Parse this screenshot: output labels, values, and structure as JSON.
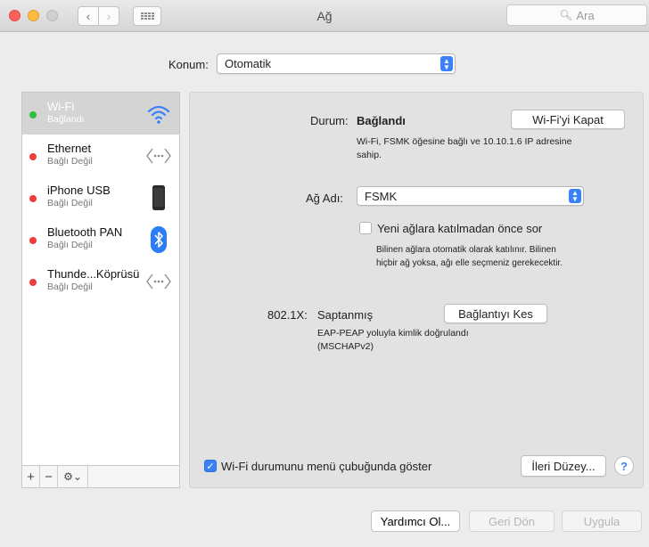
{
  "window": {
    "title": "Ağ"
  },
  "toolbar": {
    "search_placeholder": "Ara"
  },
  "location": {
    "label": "Konum:",
    "value": "Otomatik"
  },
  "sidebar": {
    "items": [
      {
        "name": "Wi-Fi",
        "status": "Bağlandı",
        "dot": "#2fbf3f",
        "icon": "wifi-icon"
      },
      {
        "name": "Ethernet",
        "status": "Bağlı Değil",
        "dot": "#f03c3c",
        "icon": "ethernet-icon"
      },
      {
        "name": "iPhone USB",
        "status": "Bağlı Değil",
        "dot": "#f03c3c",
        "icon": "iphone-icon"
      },
      {
        "name": "Bluetooth PAN",
        "status": "Bağlı Değil",
        "dot": "#f03c3c",
        "icon": "bluetooth-icon"
      },
      {
        "name": "Thunde...Köprüsü",
        "status": "Bağlı Değil",
        "dot": "#f03c3c",
        "icon": "thunderbolt-bridge-icon"
      }
    ],
    "add_label": "+",
    "remove_label": "−"
  },
  "detail": {
    "status_label": "Durum:",
    "status_value": "Bağlandı",
    "wifi_off_button": "Wi-Fi'yi Kapat",
    "status_description_line1": "Wi-Fi, FSMK öğesine bağlı ve 10.10.1.6 IP adresine",
    "status_description_line2": "sahip.",
    "network_name_label": "Ağ Adı:",
    "network_name_value": "FSMK",
    "ask_join_label": "Yeni ağlara katılmadan önce sor",
    "ask_join_checked": false,
    "ask_join_help_line1": "Bilinen ağlara otomatik olarak katılınır. Bilinen",
    "ask_join_help_line2": "hiçbir ağ yoksa, ağı elle seçmeniz gerekecektir.",
    "dot1x_label": "802.1X:",
    "dot1x_value": "Saptanmış",
    "disconnect_button": "Bağlantıyı Kes",
    "dot1x_description_line1": "EAP-PEAP yoluyla kimlik doğrulandı",
    "dot1x_description_line2": "(MSCHAPv2)",
    "show_in_menubar_label": "Wi-Fi durumunu menü çubuğunda göster",
    "show_in_menubar_checked": true,
    "advanced_button": "İleri Düzey...",
    "help_label": "?"
  },
  "footer": {
    "assist_button": "Yardımcı Ol...",
    "revert_button": "Geri Dön",
    "apply_button": "Uygula"
  },
  "colors": {
    "accent": "#3b82f7",
    "connected": "#2fbf3f",
    "disconnected": "#f03c3c"
  }
}
